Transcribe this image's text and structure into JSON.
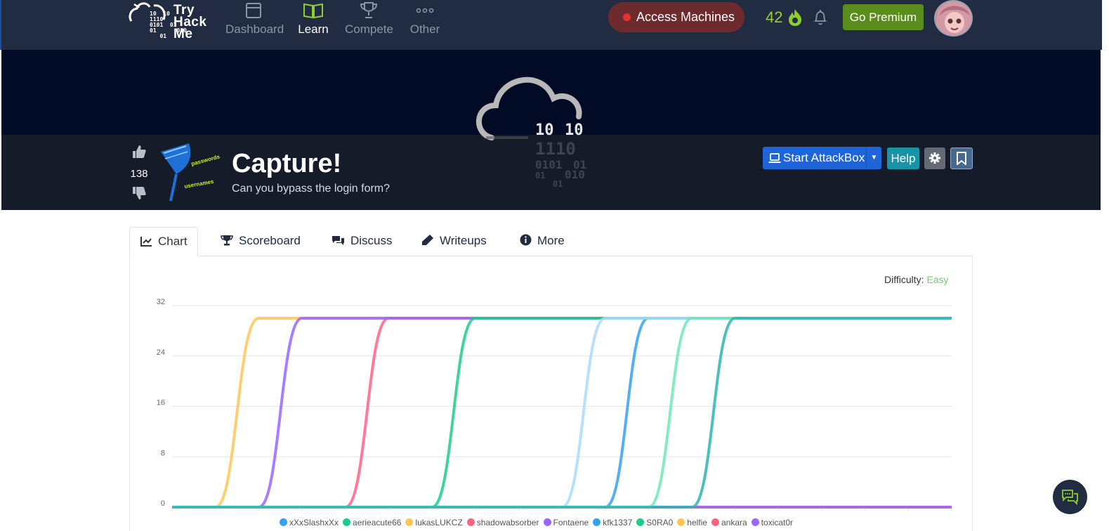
{
  "nav": {
    "logo_text": "Try\nHack\nMe",
    "logo_bits": "10  10\n1110\n0101  01\n01      010\n   01",
    "items": [
      {
        "label": "Dashboard",
        "icon": "window-icon"
      },
      {
        "label": "Learn",
        "icon": "book-icon",
        "active": true
      },
      {
        "label": "Compete",
        "icon": "trophy-icon"
      },
      {
        "label": "Other",
        "icon": "dots-icon"
      }
    ],
    "access_label": "Access Machines",
    "streak": "42",
    "premium_label": "Go Premium"
  },
  "room": {
    "votes": "138",
    "title": "Capture!",
    "subtitle": "Can you bypass the login form?",
    "icon_words": [
      "passwords",
      "usernames"
    ],
    "cloud_bits": [
      "10",
      "10",
      "1110",
      "0101",
      "01",
      "01",
      "01",
      "010"
    ],
    "attackbox_label": "Start AttackBox",
    "help_label": "Help"
  },
  "tabs": [
    {
      "label": "Chart",
      "icon": "chart-line-icon",
      "active": true
    },
    {
      "label": "Scoreboard",
      "icon": "trophy-icon"
    },
    {
      "label": "Discuss",
      "icon": "comments-icon"
    },
    {
      "label": "Writeups",
      "icon": "pen-icon"
    },
    {
      "label": "More",
      "icon": "info-icon"
    }
  ],
  "difficulty": {
    "label": "Difficulty:",
    "value": "Easy",
    "color": "#7cc47a"
  },
  "chart_data": {
    "type": "line",
    "y_ticks": [
      "0",
      "8",
      "16",
      "24",
      "32"
    ],
    "ylim": [
      0,
      32
    ],
    "x_count": 19,
    "grid": true,
    "legend_position": "bottom",
    "series": [
      {
        "name": "xXxSlashxXx",
        "color": "#36a2eb",
        "values": [
          0,
          0,
          0,
          0,
          0,
          0,
          0,
          0,
          0,
          0,
          0,
          0,
          0,
          0,
          0,
          0,
          0,
          0,
          0
        ]
      },
      {
        "name": "aerieacute66",
        "color": "#1ccc8a",
        "values": [
          0,
          0,
          0,
          0,
          0,
          0,
          0,
          0,
          0,
          0,
          0,
          0,
          0,
          0,
          0,
          0,
          0,
          0,
          0
        ]
      },
      {
        "name": "lukasLUKCZ",
        "color": "#ffc658",
        "values": [
          0,
          0,
          30,
          30,
          30,
          30,
          30,
          30,
          30,
          30,
          30,
          30,
          30,
          30,
          30,
          30,
          30,
          30,
          30
        ]
      },
      {
        "name": "shadowabsorber",
        "color": "#ff6384",
        "values": [
          0,
          0,
          0,
          0,
          0,
          30,
          30,
          30,
          30,
          30,
          30,
          30,
          30,
          30,
          30,
          30,
          30,
          30,
          30
        ]
      },
      {
        "name": "Fontaene",
        "color": "#9966ff",
        "values": [
          0,
          0,
          0,
          30,
          30,
          30,
          30,
          30,
          30,
          30,
          30,
          30,
          30,
          30,
          30,
          30,
          30,
          30,
          30
        ]
      },
      {
        "name": "kfk1337",
        "color": "#36a2eb",
        "values": [
          0,
          0,
          0,
          0,
          0,
          0,
          0,
          0,
          0,
          0,
          0,
          30,
          30,
          30,
          30,
          30,
          30,
          30,
          30
        ]
      },
      {
        "name": "S0RA0",
        "color": "#1ccc8a",
        "values": [
          0,
          0,
          0,
          0,
          0,
          0,
          0,
          30,
          30,
          30,
          30,
          30,
          30,
          30,
          30,
          30,
          30,
          30,
          30
        ]
      },
      {
        "name": "helfie",
        "color": "#ffc658",
        "values": [
          0,
          0,
          0,
          0,
          0,
          0,
          0,
          0,
          0,
          0,
          0,
          0,
          0,
          0,
          0,
          0,
          0,
          0,
          0
        ]
      },
      {
        "name": "ankara",
        "color": "#ff6384",
        "values": [
          0,
          0,
          0,
          0,
          0,
          0,
          0,
          0,
          0,
          0,
          0,
          0,
          0,
          0,
          0,
          0,
          0,
          0,
          0
        ]
      },
      {
        "name": "toxicat0r",
        "color": "#9966ff",
        "values": [
          0,
          0,
          0,
          0,
          0,
          0,
          0,
          0,
          0,
          0,
          0,
          0,
          0,
          0,
          0,
          0,
          0,
          0,
          0
        ]
      },
      {
        "name": "",
        "color": "#aadaff",
        "values": [
          0,
          0,
          0,
          0,
          0,
          0,
          0,
          0,
          0,
          0,
          30,
          30,
          30,
          30,
          30,
          30,
          30,
          30,
          30
        ]
      },
      {
        "name": "",
        "color": "#6fe8b8",
        "values": [
          0,
          0,
          0,
          0,
          0,
          0,
          0,
          0,
          0,
          0,
          0,
          0,
          30,
          30,
          30,
          30,
          30,
          30,
          30
        ]
      },
      {
        "name": "",
        "color": "#2bb5b0",
        "values": [
          0,
          0,
          0,
          0,
          0,
          0,
          0,
          0,
          0,
          0,
          0,
          0,
          0,
          30,
          30,
          30,
          30,
          30,
          30
        ]
      }
    ]
  }
}
